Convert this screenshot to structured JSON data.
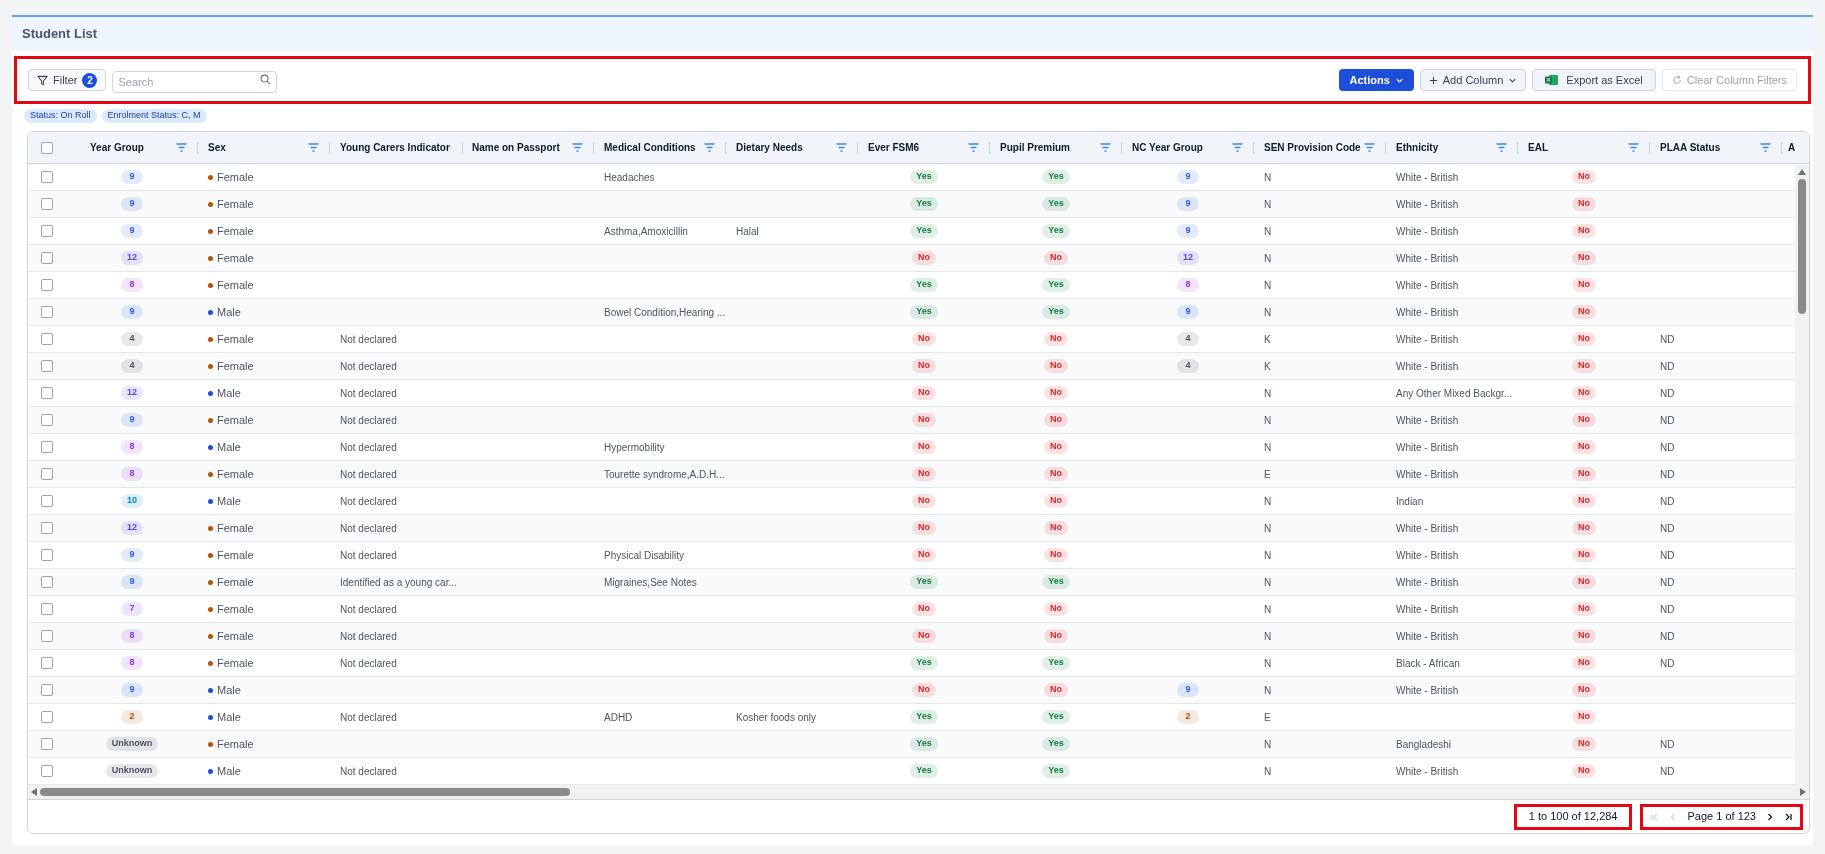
{
  "page": {
    "title": "Student List"
  },
  "toolbar": {
    "highlighted": true,
    "filter": {
      "label": "Filter",
      "count": "2"
    },
    "search": {
      "placeholder": "Search"
    },
    "actions": {
      "label": "Actions"
    },
    "add_column": {
      "label": "Add Column"
    },
    "export": {
      "label": "Export as Excel"
    },
    "clear_filters": {
      "label": "Clear Column Filters",
      "disabled": true
    }
  },
  "active_filters": [
    "Status: On Roll",
    "Enrolment Status: C, M"
  ],
  "table": {
    "columns": [
      {
        "label": "Year Group",
        "kind": "badge"
      },
      {
        "label": "Sex",
        "kind": "dot"
      },
      {
        "label": "Young Carers Indicator",
        "kind": "text"
      },
      {
        "label": "Name on Passport"
      },
      {
        "label": "Medical Conditions",
        "kind": "text"
      },
      {
        "label": "Dietary Needs",
        "kind": "text"
      },
      {
        "label": "Ever FSM6",
        "kind": "badge"
      },
      {
        "label": "Pupil Premium",
        "kind": "badge"
      },
      {
        "label": "NC Year Group",
        "kind": "badge"
      },
      {
        "label": "SEN Provision Code",
        "kind": "text"
      },
      {
        "label": "Ethnicity",
        "kind": "text"
      },
      {
        "label": "EAL",
        "kind": "badge"
      },
      {
        "label": "PLAA Status",
        "kind": "text"
      },
      {
        "label": "A"
      }
    ],
    "select_all": {
      "checked": false
    },
    "rows": [
      {
        "checked": false,
        "year_group": {
          "text": "9",
          "color": "#2563eb"
        },
        "sex": {
          "text": "Female",
          "color": "#b45309"
        },
        "medical_conditions": "Headaches",
        "ever_fsm6": {
          "text": "Yes",
          "color": "#15803d"
        },
        "pupil_premium": {
          "text": "Yes",
          "color": "#15803d"
        },
        "nc_year_group": {
          "text": "9",
          "color": "#2563eb"
        },
        "sen_provision_code": "N",
        "ethnicity": "White - British",
        "eal": {
          "text": "No",
          "color": "#dc2626"
        }
      },
      {
        "checked": false,
        "year_group": {
          "text": "9",
          "color": "#2563eb"
        },
        "sex": {
          "text": "Female",
          "color": "#b45309"
        },
        "ever_fsm6": {
          "text": "Yes",
          "color": "#15803d"
        },
        "pupil_premium": {
          "text": "Yes",
          "color": "#15803d"
        },
        "nc_year_group": {
          "text": "9",
          "color": "#2563eb"
        },
        "sen_provision_code": "N",
        "ethnicity": "White - British",
        "eal": {
          "text": "No",
          "color": "#dc2626"
        }
      },
      {
        "checked": false,
        "year_group": {
          "text": "9",
          "color": "#2563eb"
        },
        "sex": {
          "text": "Female",
          "color": "#b45309"
        },
        "medical_conditions": "Asthma,Amoxicillin",
        "dietary_needs": "Halal",
        "ever_fsm6": {
          "text": "Yes",
          "color": "#15803d"
        },
        "pupil_premium": {
          "text": "Yes",
          "color": "#15803d"
        },
        "nc_year_group": {
          "text": "9",
          "color": "#2563eb"
        },
        "sen_provision_code": "N",
        "ethnicity": "White - British",
        "eal": {
          "text": "No",
          "color": "#dc2626"
        }
      },
      {
        "checked": false,
        "year_group": {
          "text": "12",
          "color": "#4f46e5"
        },
        "sex": {
          "text": "Female",
          "color": "#b45309"
        },
        "ever_fsm6": {
          "text": "No",
          "color": "#dc2626"
        },
        "pupil_premium": {
          "text": "No",
          "color": "#dc2626"
        },
        "nc_year_group": {
          "text": "12",
          "color": "#4f46e5"
        },
        "sen_provision_code": "N",
        "ethnicity": "White - British",
        "eal": {
          "text": "No",
          "color": "#dc2626"
        }
      },
      {
        "checked": false,
        "year_group": {
          "text": "8",
          "color": "#9333ea"
        },
        "sex": {
          "text": "Female",
          "color": "#b45309"
        },
        "ever_fsm6": {
          "text": "Yes",
          "color": "#15803d"
        },
        "pupil_premium": {
          "text": "Yes",
          "color": "#15803d"
        },
        "nc_year_group": {
          "text": "8",
          "color": "#9333ea"
        },
        "sen_provision_code": "N",
        "ethnicity": "White - British",
        "eal": {
          "text": "No",
          "color": "#dc2626"
        }
      },
      {
        "checked": false,
        "year_group": {
          "text": "9",
          "color": "#2563eb"
        },
        "sex": {
          "text": "Male",
          "color": "#1d4ed8"
        },
        "medical_conditions": "Bowel Condition,Hearing ...",
        "ever_fsm6": {
          "text": "Yes",
          "color": "#15803d"
        },
        "pupil_premium": {
          "text": "Yes",
          "color": "#15803d"
        },
        "nc_year_group": {
          "text": "9",
          "color": "#2563eb"
        },
        "sen_provision_code": "N",
        "ethnicity": "White - British",
        "eal": {
          "text": "No",
          "color": "#dc2626"
        }
      },
      {
        "checked": false,
        "year_group": {
          "text": "4",
          "color": "#4b5563"
        },
        "sex": {
          "text": "Female",
          "color": "#b45309"
        },
        "young_carers_indicator": "Not declared",
        "ever_fsm6": {
          "text": "No",
          "color": "#dc2626"
        },
        "pupil_premium": {
          "text": "No",
          "color": "#dc2626"
        },
        "nc_year_group": {
          "text": "4",
          "color": "#4b5563"
        },
        "sen_provision_code": "K",
        "ethnicity": "White - British",
        "eal": {
          "text": "No",
          "color": "#dc2626"
        },
        "plaa_status": "ND"
      },
      {
        "checked": false,
        "year_group": {
          "text": "4",
          "color": "#4b5563"
        },
        "sex": {
          "text": "Female",
          "color": "#b45309"
        },
        "young_carers_indicator": "Not declared",
        "ever_fsm6": {
          "text": "No",
          "color": "#dc2626"
        },
        "pupil_premium": {
          "text": "No",
          "color": "#dc2626"
        },
        "nc_year_group": {
          "text": "4",
          "color": "#4b5563"
        },
        "sen_provision_code": "K",
        "ethnicity": "White - British",
        "eal": {
          "text": "No",
          "color": "#dc2626"
        },
        "plaa_status": "ND"
      },
      {
        "checked": false,
        "year_group": {
          "text": "12",
          "color": "#4f46e5"
        },
        "sex": {
          "text": "Male",
          "color": "#1d4ed8"
        },
        "young_carers_indicator": "Not declared",
        "ever_fsm6": {
          "text": "No",
          "color": "#dc2626"
        },
        "pupil_premium": {
          "text": "No",
          "color": "#dc2626"
        },
        "sen_provision_code": "N",
        "ethnicity": "Any Other Mixed Backgr...",
        "eal": {
          "text": "No",
          "color": "#dc2626"
        },
        "plaa_status": "ND"
      },
      {
        "checked": false,
        "year_group": {
          "text": "9",
          "color": "#2563eb"
        },
        "sex": {
          "text": "Female",
          "color": "#b45309"
        },
        "young_carers_indicator": "Not declared",
        "ever_fsm6": {
          "text": "No",
          "color": "#dc2626"
        },
        "pupil_premium": {
          "text": "No",
          "color": "#dc2626"
        },
        "sen_provision_code": "N",
        "ethnicity": "White - British",
        "eal": {
          "text": "No",
          "color": "#dc2626"
        },
        "plaa_status": "ND"
      },
      {
        "checked": false,
        "year_group": {
          "text": "8",
          "color": "#9333ea"
        },
        "sex": {
          "text": "Male",
          "color": "#1d4ed8"
        },
        "young_carers_indicator": "Not declared",
        "medical_conditions": "Hypermobility",
        "ever_fsm6": {
          "text": "No",
          "color": "#dc2626"
        },
        "pupil_premium": {
          "text": "No",
          "color": "#dc2626"
        },
        "sen_provision_code": "N",
        "ethnicity": "White - British",
        "eal": {
          "text": "No",
          "color": "#dc2626"
        },
        "plaa_status": "ND"
      },
      {
        "checked": false,
        "year_group": {
          "text": "8",
          "color": "#9333ea"
        },
        "sex": {
          "text": "Female",
          "color": "#b45309"
        },
        "young_carers_indicator": "Not declared",
        "medical_conditions": "Tourette syndrome,A.D.H...",
        "ever_fsm6": {
          "text": "No",
          "color": "#dc2626"
        },
        "pupil_premium": {
          "text": "No",
          "color": "#dc2626"
        },
        "sen_provision_code": "E",
        "ethnicity": "White - British",
        "eal": {
          "text": "No",
          "color": "#dc2626"
        },
        "plaa_status": "ND"
      },
      {
        "checked": false,
        "year_group": {
          "text": "10",
          "color": "#0284c7"
        },
        "sex": {
          "text": "Male",
          "color": "#1d4ed8"
        },
        "young_carers_indicator": "Not declared",
        "ever_fsm6": {
          "text": "No",
          "color": "#dc2626"
        },
        "pupil_premium": {
          "text": "No",
          "color": "#dc2626"
        },
        "sen_provision_code": "N",
        "ethnicity": "Indian",
        "eal": {
          "text": "No",
          "color": "#dc2626"
        },
        "plaa_status": "ND"
      },
      {
        "checked": false,
        "year_group": {
          "text": "12",
          "color": "#4f46e5"
        },
        "sex": {
          "text": "Female",
          "color": "#b45309"
        },
        "young_carers_indicator": "Not declared",
        "ever_fsm6": {
          "text": "No",
          "color": "#dc2626"
        },
        "pupil_premium": {
          "text": "No",
          "color": "#dc2626"
        },
        "sen_provision_code": "N",
        "ethnicity": "White - British",
        "eal": {
          "text": "No",
          "color": "#dc2626"
        },
        "plaa_status": "ND"
      },
      {
        "checked": false,
        "year_group": {
          "text": "9",
          "color": "#2563eb"
        },
        "sex": {
          "text": "Female",
          "color": "#b45309"
        },
        "young_carers_indicator": "Not declared",
        "medical_conditions": "Physical Disability",
        "ever_fsm6": {
          "text": "No",
          "color": "#dc2626"
        },
        "pupil_premium": {
          "text": "No",
          "color": "#dc2626"
        },
        "sen_provision_code": "N",
        "ethnicity": "White - British",
        "eal": {
          "text": "No",
          "color": "#dc2626"
        },
        "plaa_status": "ND"
      },
      {
        "checked": false,
        "year_group": {
          "text": "9",
          "color": "#2563eb"
        },
        "sex": {
          "text": "Female",
          "color": "#b45309"
        },
        "young_carers_indicator": "Identified as a young car...",
        "medical_conditions": "Migraines,See Notes",
        "ever_fsm6": {
          "text": "Yes",
          "color": "#15803d"
        },
        "pupil_premium": {
          "text": "Yes",
          "color": "#15803d"
        },
        "sen_provision_code": "N",
        "ethnicity": "White - British",
        "eal": {
          "text": "No",
          "color": "#dc2626"
        },
        "plaa_status": "ND"
      },
      {
        "checked": false,
        "year_group": {
          "text": "7",
          "color": "#7c3aed"
        },
        "sex": {
          "text": "Female",
          "color": "#b45309"
        },
        "young_carers_indicator": "Not declared",
        "ever_fsm6": {
          "text": "No",
          "color": "#dc2626"
        },
        "pupil_premium": {
          "text": "No",
          "color": "#dc2626"
        },
        "sen_provision_code": "N",
        "ethnicity": "White - British",
        "eal": {
          "text": "No",
          "color": "#dc2626"
        },
        "plaa_status": "ND"
      },
      {
        "checked": false,
        "year_group": {
          "text": "8",
          "color": "#9333ea"
        },
        "sex": {
          "text": "Female",
          "color": "#b45309"
        },
        "young_carers_indicator": "Not declared",
        "ever_fsm6": {
          "text": "No",
          "color": "#dc2626"
        },
        "pupil_premium": {
          "text": "No",
          "color": "#dc2626"
        },
        "sen_provision_code": "N",
        "ethnicity": "White - British",
        "eal": {
          "text": "No",
          "color": "#dc2626"
        },
        "plaa_status": "ND"
      },
      {
        "checked": false,
        "year_group": {
          "text": "8",
          "color": "#9333ea"
        },
        "sex": {
          "text": "Female",
          "color": "#b45309"
        },
        "young_carers_indicator": "Not declared",
        "ever_fsm6": {
          "text": "Yes",
          "color": "#15803d"
        },
        "pupil_premium": {
          "text": "Yes",
          "color": "#15803d"
        },
        "sen_provision_code": "N",
        "ethnicity": "Black - African",
        "eal": {
          "text": "No",
          "color": "#dc2626"
        },
        "plaa_status": "ND"
      },
      {
        "checked": false,
        "year_group": {
          "text": "9",
          "color": "#2563eb"
        },
        "sex": {
          "text": "Male",
          "color": "#1d4ed8"
        },
        "ever_fsm6": {
          "text": "No",
          "color": "#dc2626"
        },
        "pupil_premium": {
          "text": "No",
          "color": "#dc2626"
        },
        "nc_year_group": {
          "text": "9",
          "color": "#2563eb"
        },
        "sen_provision_code": "N",
        "ethnicity": "White - British",
        "eal": {
          "text": "No",
          "color": "#dc2626"
        }
      },
      {
        "checked": false,
        "year_group": {
          "text": "2",
          "color": "#b45309"
        },
        "sex": {
          "text": "Male",
          "color": "#1d4ed8"
        },
        "young_carers_indicator": "Not declared",
        "medical_conditions": "ADHD",
        "dietary_needs": "Kosher foods only",
        "ever_fsm6": {
          "text": "Yes",
          "color": "#15803d"
        },
        "pupil_premium": {
          "text": "Yes",
          "color": "#15803d"
        },
        "nc_year_group": {
          "text": "2",
          "color": "#b45309"
        },
        "sen_provision_code": "E",
        "eal": {
          "text": "No",
          "color": "#dc2626"
        }
      },
      {
        "checked": false,
        "year_group": {
          "text": "Unknown",
          "color": "#4b5563"
        },
        "sex": {
          "text": "Female",
          "color": "#b45309"
        },
        "ever_fsm6": {
          "text": "Yes",
          "color": "#15803d"
        },
        "pupil_premium": {
          "text": "Yes",
          "color": "#15803d"
        },
        "sen_provision_code": "N",
        "ethnicity": "Bangladeshi",
        "eal": {
          "text": "No",
          "color": "#dc2626"
        },
        "plaa_status": "ND"
      },
      {
        "checked": false,
        "year_group": {
          "text": "Unknown",
          "color": "#4b5563"
        },
        "sex": {
          "text": "Male",
          "color": "#1d4ed8"
        },
        "young_carers_indicator": "Not declared",
        "ever_fsm6": {
          "text": "Yes",
          "color": "#15803d"
        },
        "pupil_premium": {
          "text": "Yes",
          "color": "#15803d"
        },
        "sen_provision_code": "N",
        "ethnicity": "White - British",
        "eal": {
          "text": "No",
          "color": "#dc2626"
        },
        "plaa_status": "ND"
      }
    ]
  },
  "footer": {
    "record_count": {
      "text": "1 to 100 of 12,284",
      "highlighted": true
    },
    "pager": {
      "highlighted": true,
      "label": "Page 1 of 123",
      "first": {
        "disabled": true
      },
      "previous": {
        "disabled": true
      },
      "next": {
        "disabled": false
      },
      "last": {
        "disabled": false
      }
    }
  }
}
